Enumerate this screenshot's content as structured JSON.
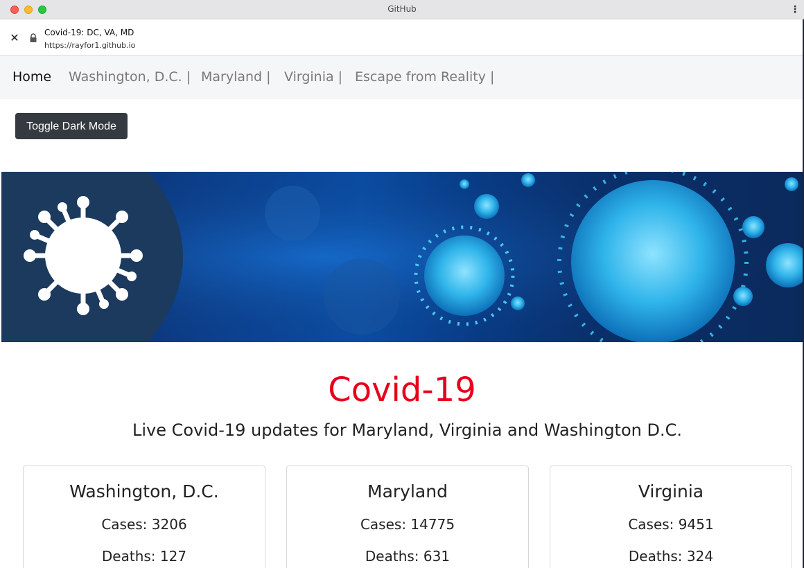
{
  "window": {
    "title": "GitHub"
  },
  "urlbar": {
    "page_name": "Covid-19: DC, VA, MD",
    "url": "https://rayfor1.github.io"
  },
  "nav": {
    "items": [
      {
        "label": "Home"
      },
      {
        "label": "Washington, D.C. |"
      },
      {
        "label": "Maryland |"
      },
      {
        "label": "Virginia |"
      },
      {
        "label": "Escape from Reality |"
      }
    ]
  },
  "toggle": {
    "label": "Toggle Dark Mode"
  },
  "banner": {
    "icon": "virus-icon"
  },
  "main": {
    "title": "Covid-19",
    "subtitle": "Live Covid-19 updates for Maryland, Virginia and Washington D.C."
  },
  "cards": [
    {
      "title": "Washington, D.C.",
      "cases": "Cases: 3206",
      "deaths": "Deaths: 127"
    },
    {
      "title": "Maryland",
      "cases": "Cases: 14775",
      "deaths": "Deaths: 631"
    },
    {
      "title": "Virginia",
      "cases": "Cases: 9451",
      "deaths": "Deaths: 324"
    }
  ],
  "colors": {
    "accent_red": "#e8001b",
    "button_dark": "#343a40",
    "banner_navy": "#1b3a5e"
  }
}
